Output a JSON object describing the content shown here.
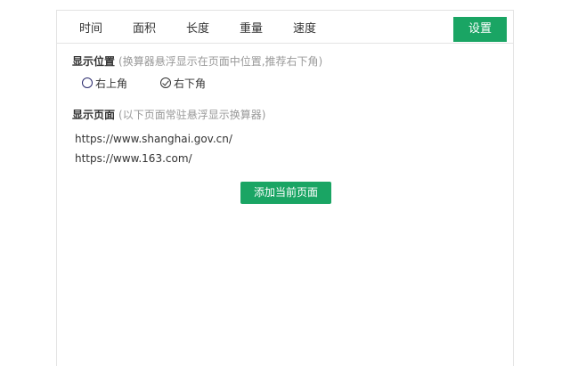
{
  "tabs": [
    {
      "label": "时间"
    },
    {
      "label": "面积"
    },
    {
      "label": "长度"
    },
    {
      "label": "重量"
    },
    {
      "label": "速度"
    }
  ],
  "settings_label": "设置",
  "position_section": {
    "title": "显示位置",
    "hint": "(换算器悬浮显示在页面中位置,推荐右下角)",
    "options": [
      {
        "label": "右上角",
        "checked": false
      },
      {
        "label": "右下角",
        "checked": true
      }
    ]
  },
  "pages_section": {
    "title": "显示页面",
    "hint": "(以下页面常驻悬浮显示换算器)",
    "urls": [
      "https://www.shanghai.gov.cn/",
      "https://www.163.com/"
    ]
  },
  "add_button_label": "添加当前页面",
  "colors": {
    "accent": "#1aa564"
  }
}
